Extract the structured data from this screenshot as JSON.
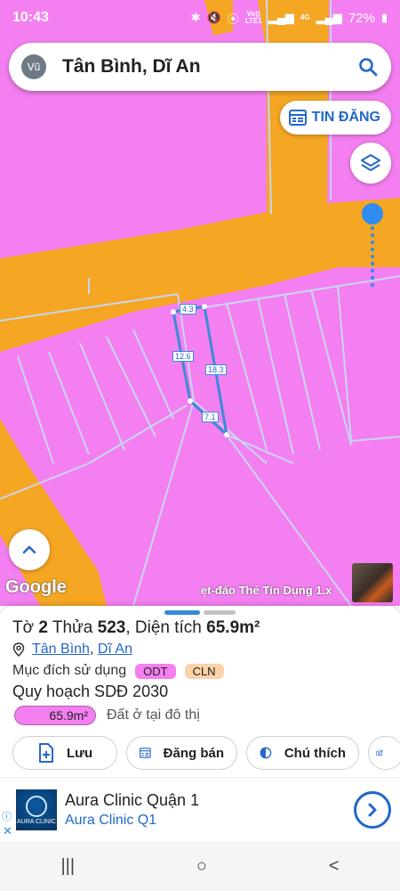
{
  "status_bar": {
    "time": "10:43",
    "network_top": "Vo))",
    "network_bottom": "LTE1",
    "signal_label": "4G",
    "battery": "72%"
  },
  "search": {
    "avatar_text": "Vũ",
    "query": "Tân Bình, Dĩ An",
    "icon": "search-icon"
  },
  "map": {
    "post_button_label": "TIN ĐĂNG",
    "layers_icon": "layers-icon",
    "up_icon": "chevron-up-icon",
    "logo_text": "Google",
    "ticker_text": "ẹt-đáo Thẻ Tín Dụng 1.x",
    "colors": {
      "residential": "#f47ff0",
      "road": "#f5a623",
      "parcel_outline": "#3a8ad6"
    },
    "dimensions": {
      "top": "4.3",
      "left": "12.6",
      "right": "18.3",
      "bottom": "7.1"
    }
  },
  "parcel": {
    "to_label": "Tờ",
    "to_value": "2",
    "thua_label": "Thửa",
    "thua_value": "523",
    "area_label": "Diện tích",
    "area_value": "65.9m²",
    "ward": "Tân Bình",
    "city": "Dĩ An",
    "purpose_label": "Mục đích sử dụng",
    "purpose_codes": [
      "ODT",
      "CLN"
    ],
    "plan_label": "Quy hoạch SDĐ 2030",
    "plan_area": "65.9m²",
    "plan_desc": "Đất ở tại đô thị"
  },
  "actions": {
    "save": "Lưu",
    "sell": "Đăng bán",
    "legend": "Chú thích"
  },
  "ad": {
    "logo_text": "AURA CLINIC",
    "title": "Aura Clinic Quận 1",
    "subtitle": "Aura Clinic Q1",
    "info_icon": "ⓘ",
    "close_icon": "✕"
  },
  "nav": {
    "recents": "|||",
    "home": "○",
    "back": "<"
  }
}
